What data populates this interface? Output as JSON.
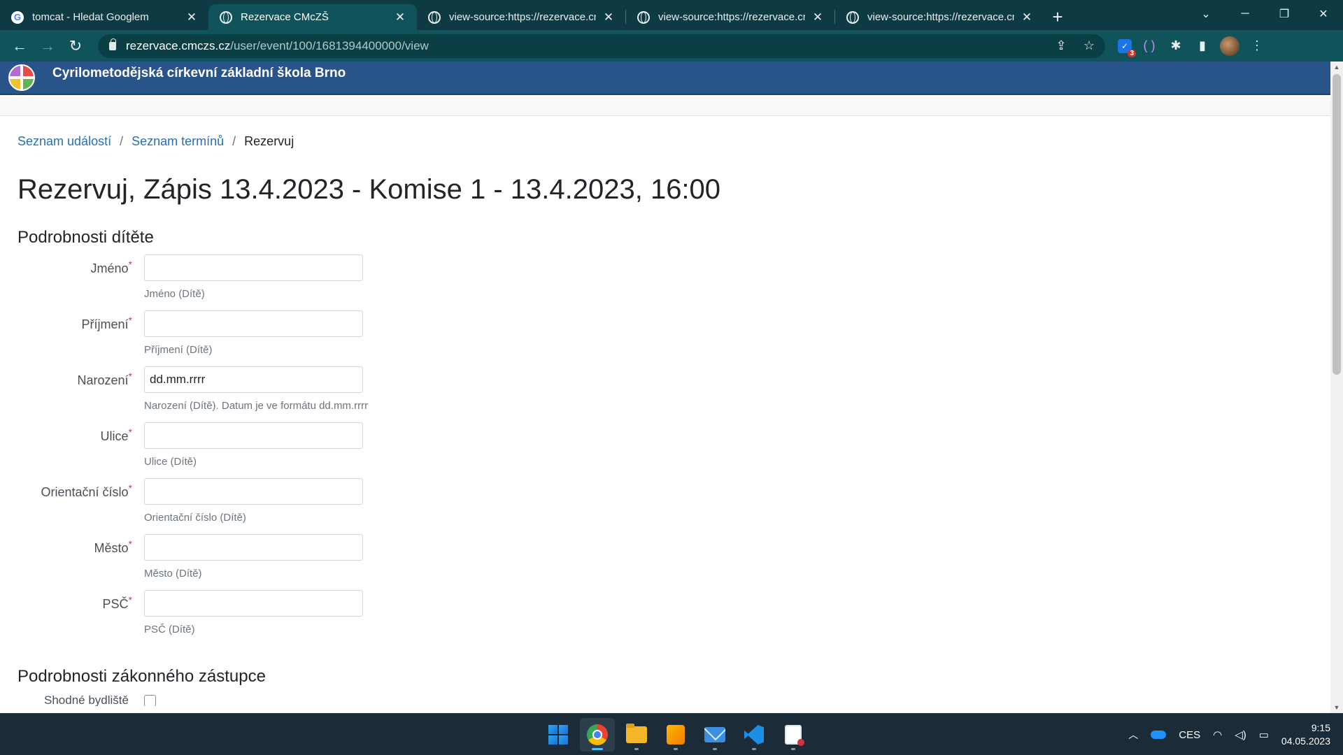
{
  "browser": {
    "tabs": [
      {
        "title": "tomcat - Hledat Googlem",
        "icon": "google-icon",
        "active": false
      },
      {
        "title": "Rezervace CMcZŠ",
        "icon": "globe-icon",
        "active": true
      },
      {
        "title": "view-source:https://rezervace.cm",
        "icon": "globe-icon",
        "active": false
      },
      {
        "title": "view-source:https://rezervace.cm",
        "icon": "globe-icon",
        "active": false
      },
      {
        "title": "view-source:https://rezervace.cm",
        "icon": "globe-icon",
        "active": false
      }
    ],
    "url_host": "rezervace.cmczs.cz",
    "url_path": "/user/event/100/1681394400000/view",
    "extension_badge": "3"
  },
  "site": {
    "title": "Cyrilometodějská církevní základní škola Brno"
  },
  "breadcrumb": {
    "items": [
      "Seznam událostí",
      "Seznam termínů"
    ],
    "current": "Rezervuj",
    "separator": "/"
  },
  "page": {
    "heading": "Rezervuj, Zápis 13.4.2023 - Komise 1 - 13.4.2023, 16:00"
  },
  "child_section": {
    "title": "Podrobnosti dítěte",
    "fields": [
      {
        "label": "Jméno",
        "value": "",
        "placeholder": "",
        "help": "Jméno (Dítě)"
      },
      {
        "label": "Příjmení",
        "value": "",
        "placeholder": "",
        "help": "Příjmení (Dítě)"
      },
      {
        "label": "Narození",
        "value": "dd.mm.rrrr",
        "placeholder": "",
        "help": "Narození (Dítě). Datum je ve formátu dd.mm.rrrr"
      },
      {
        "label": "Ulice",
        "value": "",
        "placeholder": "",
        "help": "Ulice (Dítě)"
      },
      {
        "label": "Orientační číslo",
        "value": "",
        "placeholder": "",
        "help": "Orientační číslo (Dítě)"
      },
      {
        "label": "Město",
        "value": "",
        "placeholder": "",
        "help": "Město (Dítě)"
      },
      {
        "label": "PSČ",
        "value": "",
        "placeholder": "",
        "help": "PSČ (Dítě)"
      }
    ],
    "required_mark": "*"
  },
  "guardian_section": {
    "title": "Podrobnosti zákonného zástupce",
    "first_field_label": "Shodné bydliště"
  },
  "taskbar": {
    "language": "CES",
    "time": "9:15",
    "date": "04.05.2023"
  },
  "colors": {
    "tab_strip": "#0e3b43",
    "toolbar": "#11535b",
    "site_header": "#285489",
    "link": "#2a6fb4",
    "required": "#dc3545",
    "taskbar": "#1c2b38"
  }
}
